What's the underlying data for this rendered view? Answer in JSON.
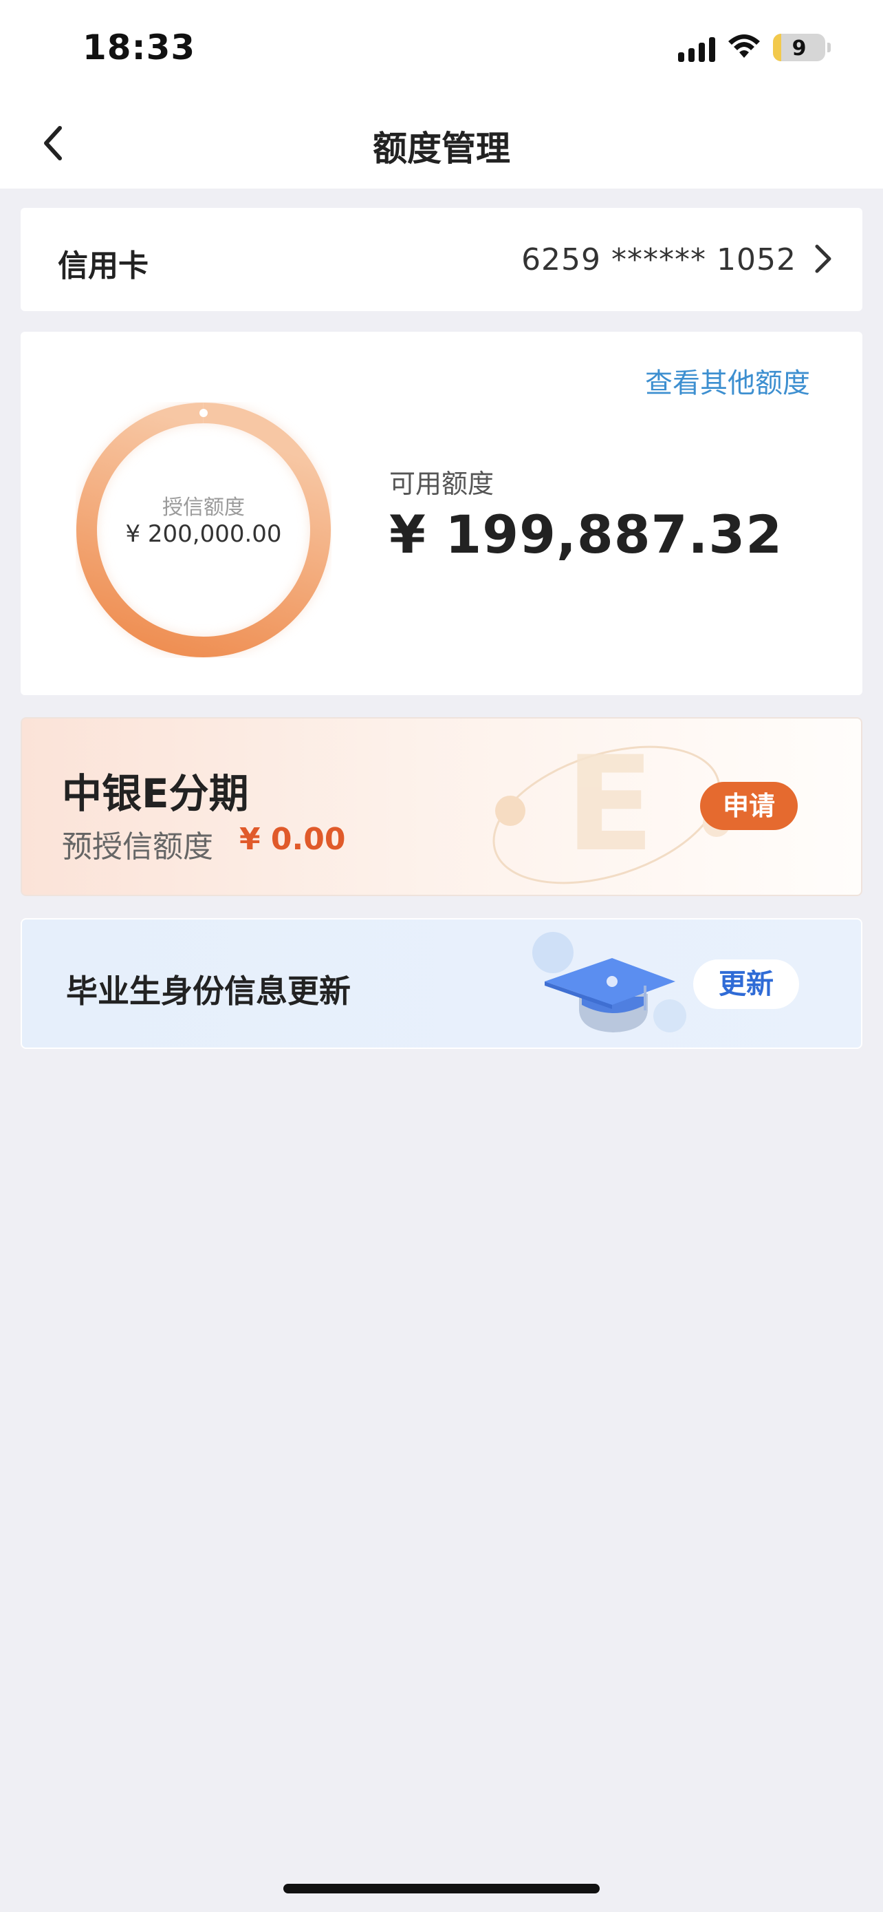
{
  "status_bar": {
    "time": "18:33",
    "battery_level": "9",
    "icons": [
      "signal-icon",
      "wifi-icon",
      "battery-icon"
    ]
  },
  "nav": {
    "title": "额度管理",
    "back_icon": "chevron-left-icon"
  },
  "credit_card": {
    "label": "信用卡",
    "number": "6259 ****** 1052",
    "chevron_icon": "chevron-right-icon"
  },
  "limit": {
    "other_link": "查看其他额度",
    "ring_caption": "授信额度",
    "credit_limit": "¥ 200,000.00",
    "available_label": "可用额度",
    "available_amount": "¥ 199,887.32",
    "available_fraction": 0.99944,
    "colors": {
      "ring_start": "#ee8a4c",
      "ring_end": "#f7c7a4"
    }
  },
  "installment": {
    "title": "中银E分期",
    "sub_label": "预授信额度",
    "amount": "¥ 0.00",
    "apply_label": "申请",
    "accent": "#e56a2f"
  },
  "graduate": {
    "title": "毕业生身份信息更新",
    "update_label": "更新",
    "illustration": "graduation-cap-icon",
    "accent": "#2f6bd6"
  }
}
